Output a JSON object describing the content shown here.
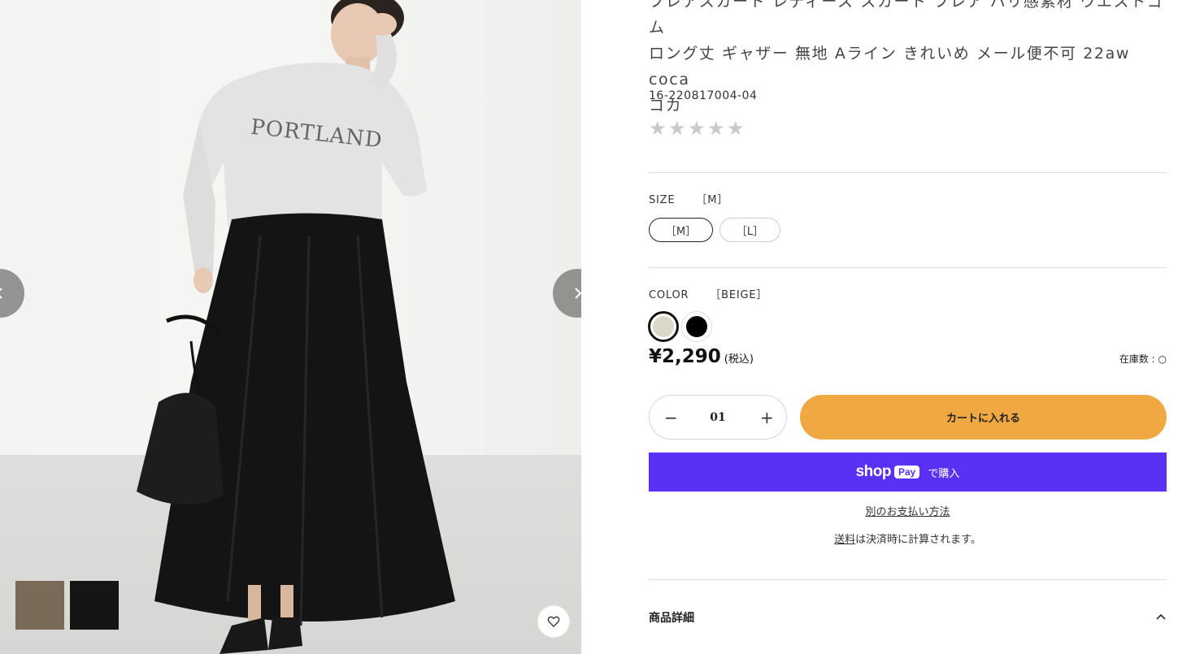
{
  "product": {
    "title": "フレアスカート レディース スカート フレア ハリ感素材 ウエストゴム\nロング丈 ギャザー 無地 Aライン きれいめ メール便不可 22aw coca\nコカ",
    "sku": "16-220817004-04",
    "stars": [
      "★",
      "★",
      "★",
      "★",
      "★"
    ]
  },
  "gallery": {
    "sweatshirt_print": "PORTLAND",
    "thumbnail_colors": [
      "#7a6a58",
      "#151515"
    ]
  },
  "size": {
    "label": "SIZE",
    "selected": "［M］",
    "options": [
      "［M］",
      "［L］"
    ]
  },
  "color": {
    "label": "COLOR",
    "selected": "［BEIGE］",
    "swatches": [
      "#dcd8c8",
      "#000000"
    ]
  },
  "price": {
    "amount": "¥2,290",
    "tax_note": "(税込)"
  },
  "stock": {
    "label": "在庫数 : ",
    "symbol": "○"
  },
  "quantity": {
    "value": "01",
    "minus": "−",
    "plus": "+"
  },
  "buttons": {
    "add_to_cart": "カートに入れる",
    "shoppay_brand": "shop",
    "shoppay_pay": "Pay",
    "shoppay_text": "で購入",
    "alt_payment": "別のお支払い方法"
  },
  "shipping": {
    "link": "送料",
    "text": "は決済時に計算されます。"
  },
  "details": {
    "label": "商品詳細"
  },
  "colors": {
    "accent_cart": "#f0a843",
    "shoppay": "#5a31f4"
  }
}
